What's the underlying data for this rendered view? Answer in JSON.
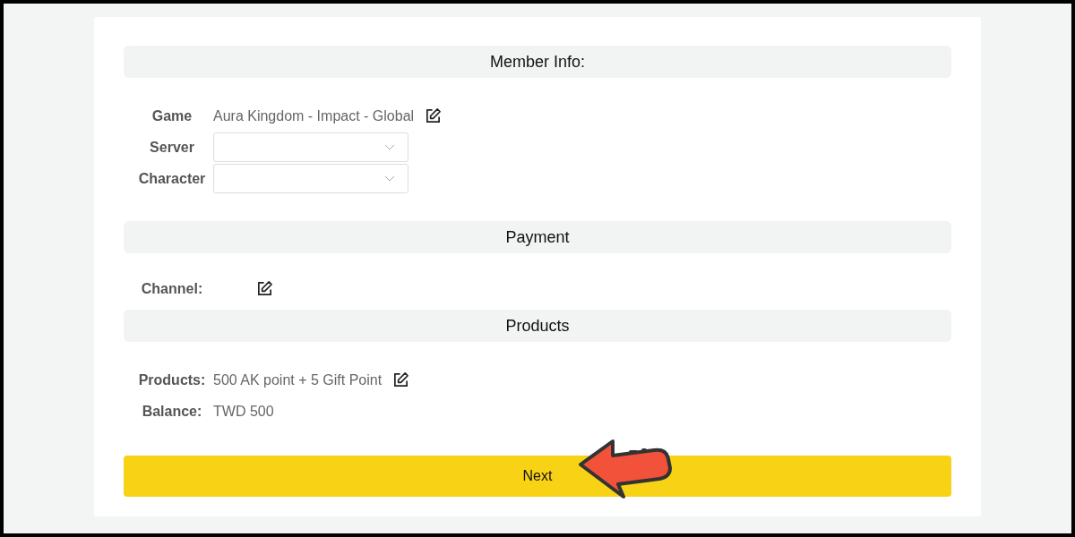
{
  "sections": [
    {
      "title": "Member Info:",
      "rows": [
        {
          "kind": "text",
          "label": "Game",
          "value": "Aura Kingdom - Impact - Global",
          "editable": true
        },
        {
          "kind": "select",
          "label": "Server"
        },
        {
          "kind": "select",
          "label": "Character"
        }
      ]
    },
    {
      "title": "Payment",
      "rows": [
        {
          "kind": "text",
          "label": "Channel:",
          "editable": true
        }
      ]
    },
    {
      "title": "Products",
      "rows": [
        {
          "kind": "text",
          "label": "Products:",
          "value": "500 AK point + 5 Gift Point",
          "editable": true
        },
        {
          "kind": "text",
          "label": "Balance:",
          "value": "TWD 500",
          "editable": false
        }
      ]
    }
  ],
  "next_button": {
    "label": "Next"
  }
}
